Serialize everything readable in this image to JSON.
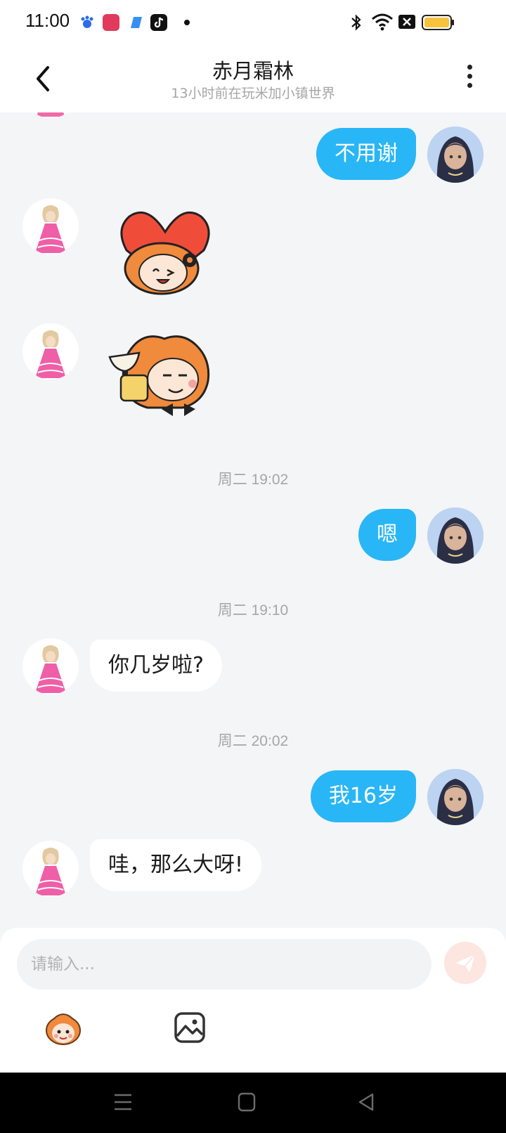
{
  "status_bar": {
    "time": "11:00",
    "icons": [
      "baidu-icon",
      "app-badge-icon",
      "blue-app-icon",
      "tiktok-icon",
      "bluetooth-icon",
      "wifi-icon",
      "sim-off-icon",
      "battery-icon"
    ]
  },
  "header": {
    "title": "赤月霜林",
    "subtitle": "13小时前在玩米加小镇世界"
  },
  "messages": [
    {
      "type": "text",
      "side": "right",
      "text": "不用谢"
    },
    {
      "type": "sticker",
      "side": "left",
      "sticker": "heart-holding-sticker"
    },
    {
      "type": "sticker",
      "side": "left",
      "sticker": "toast-sticker"
    },
    {
      "type": "timestamp",
      "text": "周二 19:02"
    },
    {
      "type": "text",
      "side": "right",
      "text": "嗯"
    },
    {
      "type": "timestamp",
      "text": "周二 19:10"
    },
    {
      "type": "text",
      "side": "left",
      "text": "你几岁啦?"
    },
    {
      "type": "timestamp",
      "text": "周二 20:02"
    },
    {
      "type": "text",
      "side": "right",
      "text": "我16岁"
    },
    {
      "type": "text",
      "side": "left",
      "text": "哇，那么大呀!"
    }
  ],
  "input": {
    "placeholder": "请输入..."
  },
  "colors": {
    "accent": "#29b6f6",
    "chat_background": "#f4f5f7",
    "send_button": "#fde5e0"
  }
}
